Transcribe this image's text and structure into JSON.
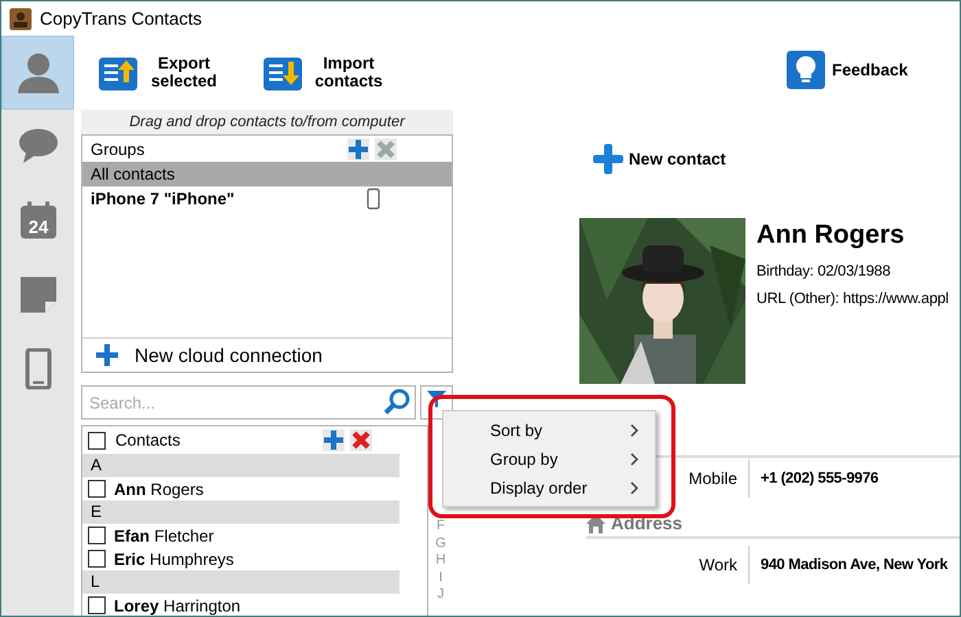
{
  "window": {
    "title": "CopyTrans Contacts"
  },
  "sidebar": {
    "items": [
      {
        "kind": "contacts",
        "selected": true
      },
      {
        "kind": "messages",
        "selected": false
      },
      {
        "kind": "calendar",
        "badge": "24",
        "selected": false
      },
      {
        "kind": "notes",
        "selected": false
      },
      {
        "kind": "device",
        "selected": false
      }
    ]
  },
  "toolbar": {
    "buttons": [
      {
        "kind": "export",
        "label": "Export selected"
      },
      {
        "kind": "import",
        "label": "Import contacts"
      }
    ],
    "feedback": "Feedback"
  },
  "drop_hint": "Drag and drop contacts to/from computer",
  "groups": {
    "header": "Groups",
    "items": [
      {
        "label": "All contacts",
        "kind": "group",
        "selected": true
      },
      {
        "label": "iPhone 7 \"iPhone\"",
        "kind": "device",
        "selected": false
      }
    ],
    "new_connection": "New cloud connection"
  },
  "search": {
    "placeholder": "Search..."
  },
  "contacts": {
    "header": "Contacts",
    "checked": false,
    "rows": [
      {
        "kind": "section",
        "label": "A"
      },
      {
        "kind": "contact",
        "first": "Ann",
        "last": "Rogers",
        "checked": false
      },
      {
        "kind": "section",
        "label": "E"
      },
      {
        "kind": "contact",
        "first": "Efan",
        "last": "Fletcher",
        "checked": false
      },
      {
        "kind": "contact",
        "first": "Eric",
        "last": "Humphreys",
        "checked": false
      },
      {
        "kind": "section",
        "label": "L"
      },
      {
        "kind": "contact",
        "first": "Lorey",
        "last": "Harrington",
        "checked": false
      }
    ]
  },
  "alphabet": [
    {
      "letter": "F",
      "active": false
    },
    {
      "letter": "G",
      "active": false
    },
    {
      "letter": "H",
      "active": false
    },
    {
      "letter": "I",
      "active": false
    },
    {
      "letter": "J",
      "active": false
    }
  ],
  "detail": {
    "new_contact": "New contact",
    "name": "Ann Rogers",
    "fields": [
      "Birthday: 02/03/1988",
      "URL (Other): https://www.appl"
    ],
    "phones": [
      {
        "label": "Mobile",
        "value": "+1 (202) 555-9976"
      }
    ],
    "address_header": "Address",
    "addresses": [
      {
        "label": "Work",
        "value": "940 Madison Ave, New York"
      }
    ]
  },
  "context_menu": {
    "items": [
      {
        "label": "Sort by",
        "submenu": true
      },
      {
        "label": "Group by",
        "submenu": true
      },
      {
        "label": "Display order",
        "submenu": true
      }
    ]
  }
}
